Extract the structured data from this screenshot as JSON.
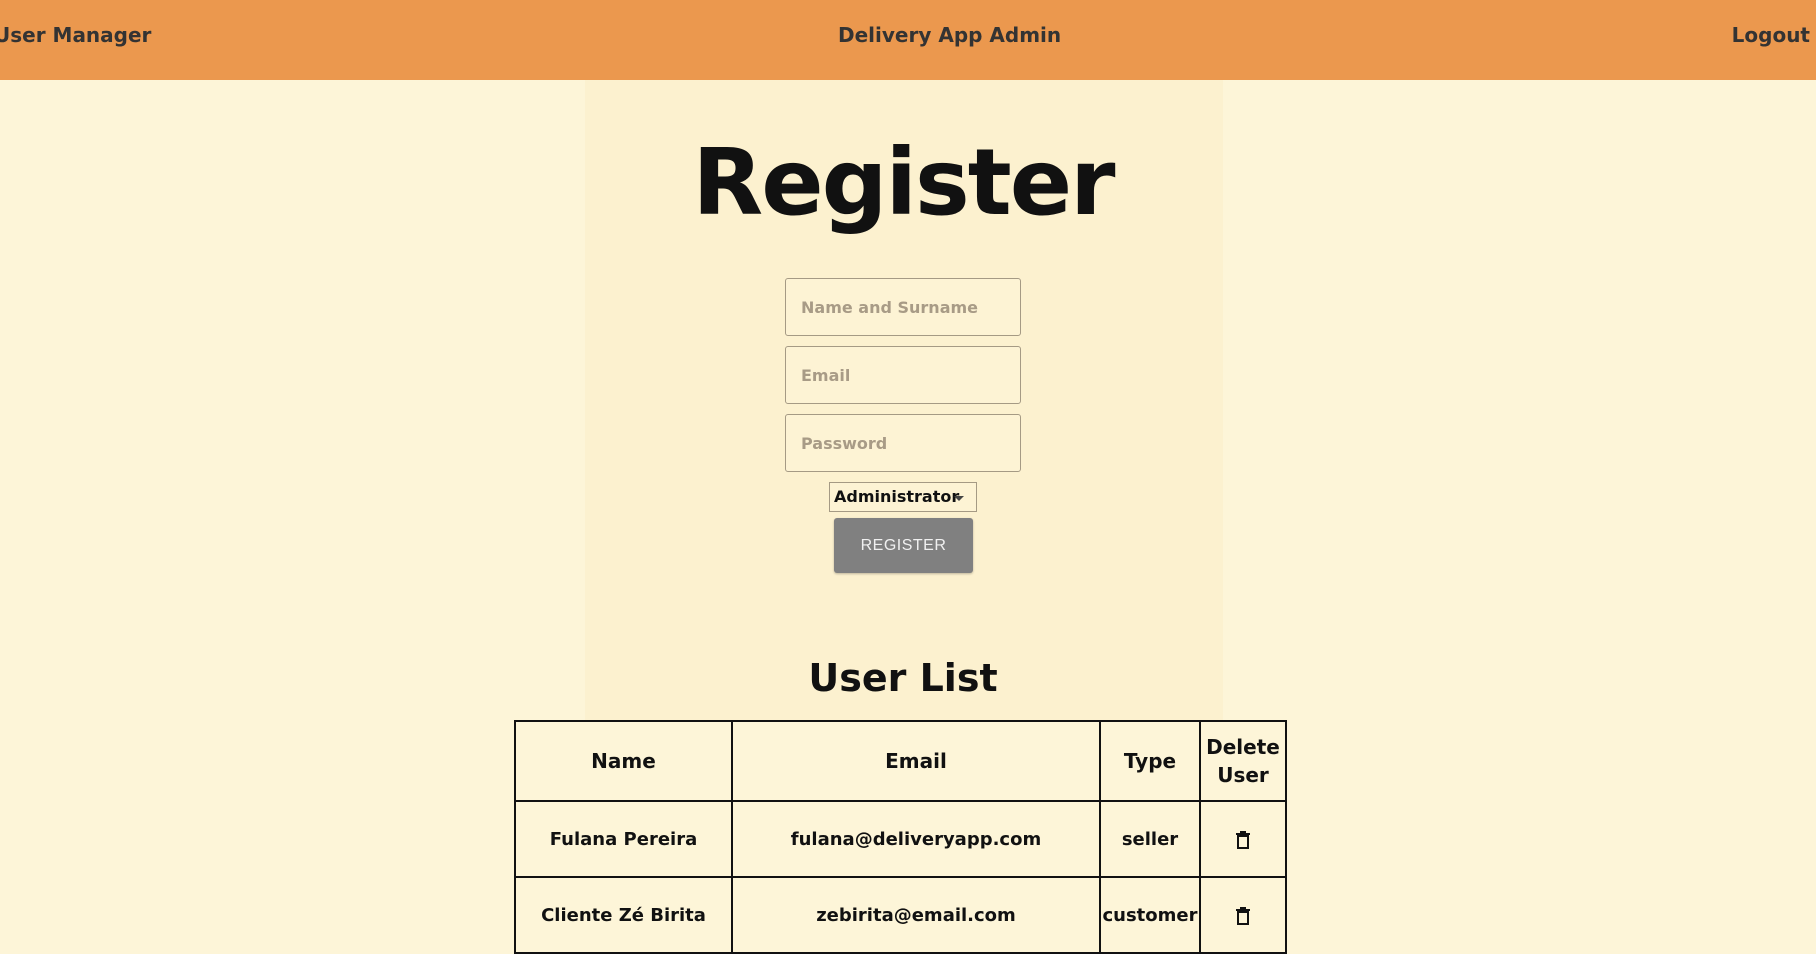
{
  "header": {
    "left_link": "User Manager",
    "title": "Delivery App Admin",
    "logout": "Logout"
  },
  "form": {
    "title": "Register",
    "name_placeholder": "Name and Surname",
    "email_placeholder": "Email",
    "password_placeholder": "Password",
    "role_selected": "Administrator",
    "submit_label": "REGISTER"
  },
  "user_list": {
    "title": "User List",
    "columns": [
      "Name",
      "Email",
      "Type",
      "Delete User"
    ],
    "rows": [
      {
        "name": "Fulana Pereira",
        "email": "fulana@deliveryapp.com",
        "type": "seller",
        "delete_icon": "trash-icon"
      },
      {
        "name": "Cliente Zé Birita",
        "email": "zebirita@email.com",
        "type": "customer",
        "delete_icon": "trash-icon"
      }
    ]
  },
  "colors": {
    "header_bg": "#eb984e",
    "page_bg": "#fdf5d8",
    "button_bg": "#808080"
  }
}
